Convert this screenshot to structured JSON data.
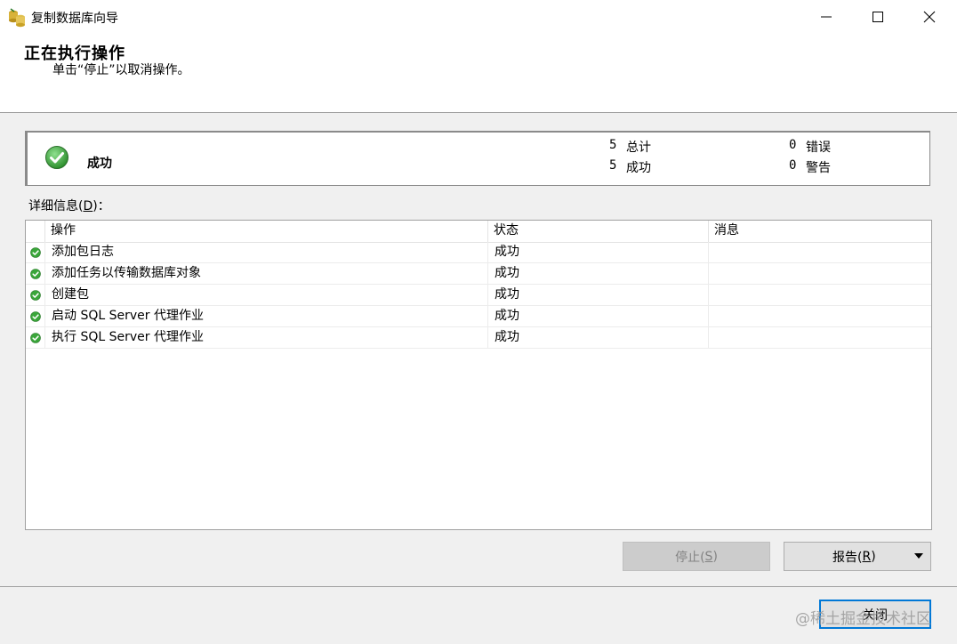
{
  "window": {
    "title": "复制数据库向导",
    "icon": "database-wizard-icon"
  },
  "header": {
    "title": "正在执行操作",
    "subtitle": "单击“停止”以取消操作。"
  },
  "summary": {
    "status": "成功",
    "status_icon": "success-check-icon",
    "total_count": "5",
    "total_label": "总计",
    "success_count": "5",
    "success_label": "成功",
    "error_count": "0",
    "error_label": "错误",
    "warning_count": "0",
    "warning_label": "警告"
  },
  "details": {
    "label_prefix": "详细信息(",
    "label_key": "D",
    "label_suffix": ")：",
    "columns": [
      "操作",
      "状态",
      "消息"
    ],
    "rows": [
      {
        "action": "添加包日志",
        "status": "成功",
        "message": ""
      },
      {
        "action": "添加任务以传输数据库对象",
        "status": "成功",
        "message": ""
      },
      {
        "action": "创建包",
        "status": "成功",
        "message": ""
      },
      {
        "action": "启动 SQL Server 代理作业",
        "status": "成功",
        "message": ""
      },
      {
        "action": "执行 SQL Server 代理作业",
        "status": "成功",
        "message": ""
      }
    ]
  },
  "buttons": {
    "stop_prefix": "停止(",
    "stop_key": "S",
    "stop_suffix": ")",
    "report_prefix": "报告(",
    "report_key": "R",
    "report_suffix": ")",
    "close": "关闭"
  },
  "watermark": "@稀土掘金技术社区",
  "colors": {
    "success_green": "#3aa63a",
    "focus_blue": "#0078d7"
  }
}
